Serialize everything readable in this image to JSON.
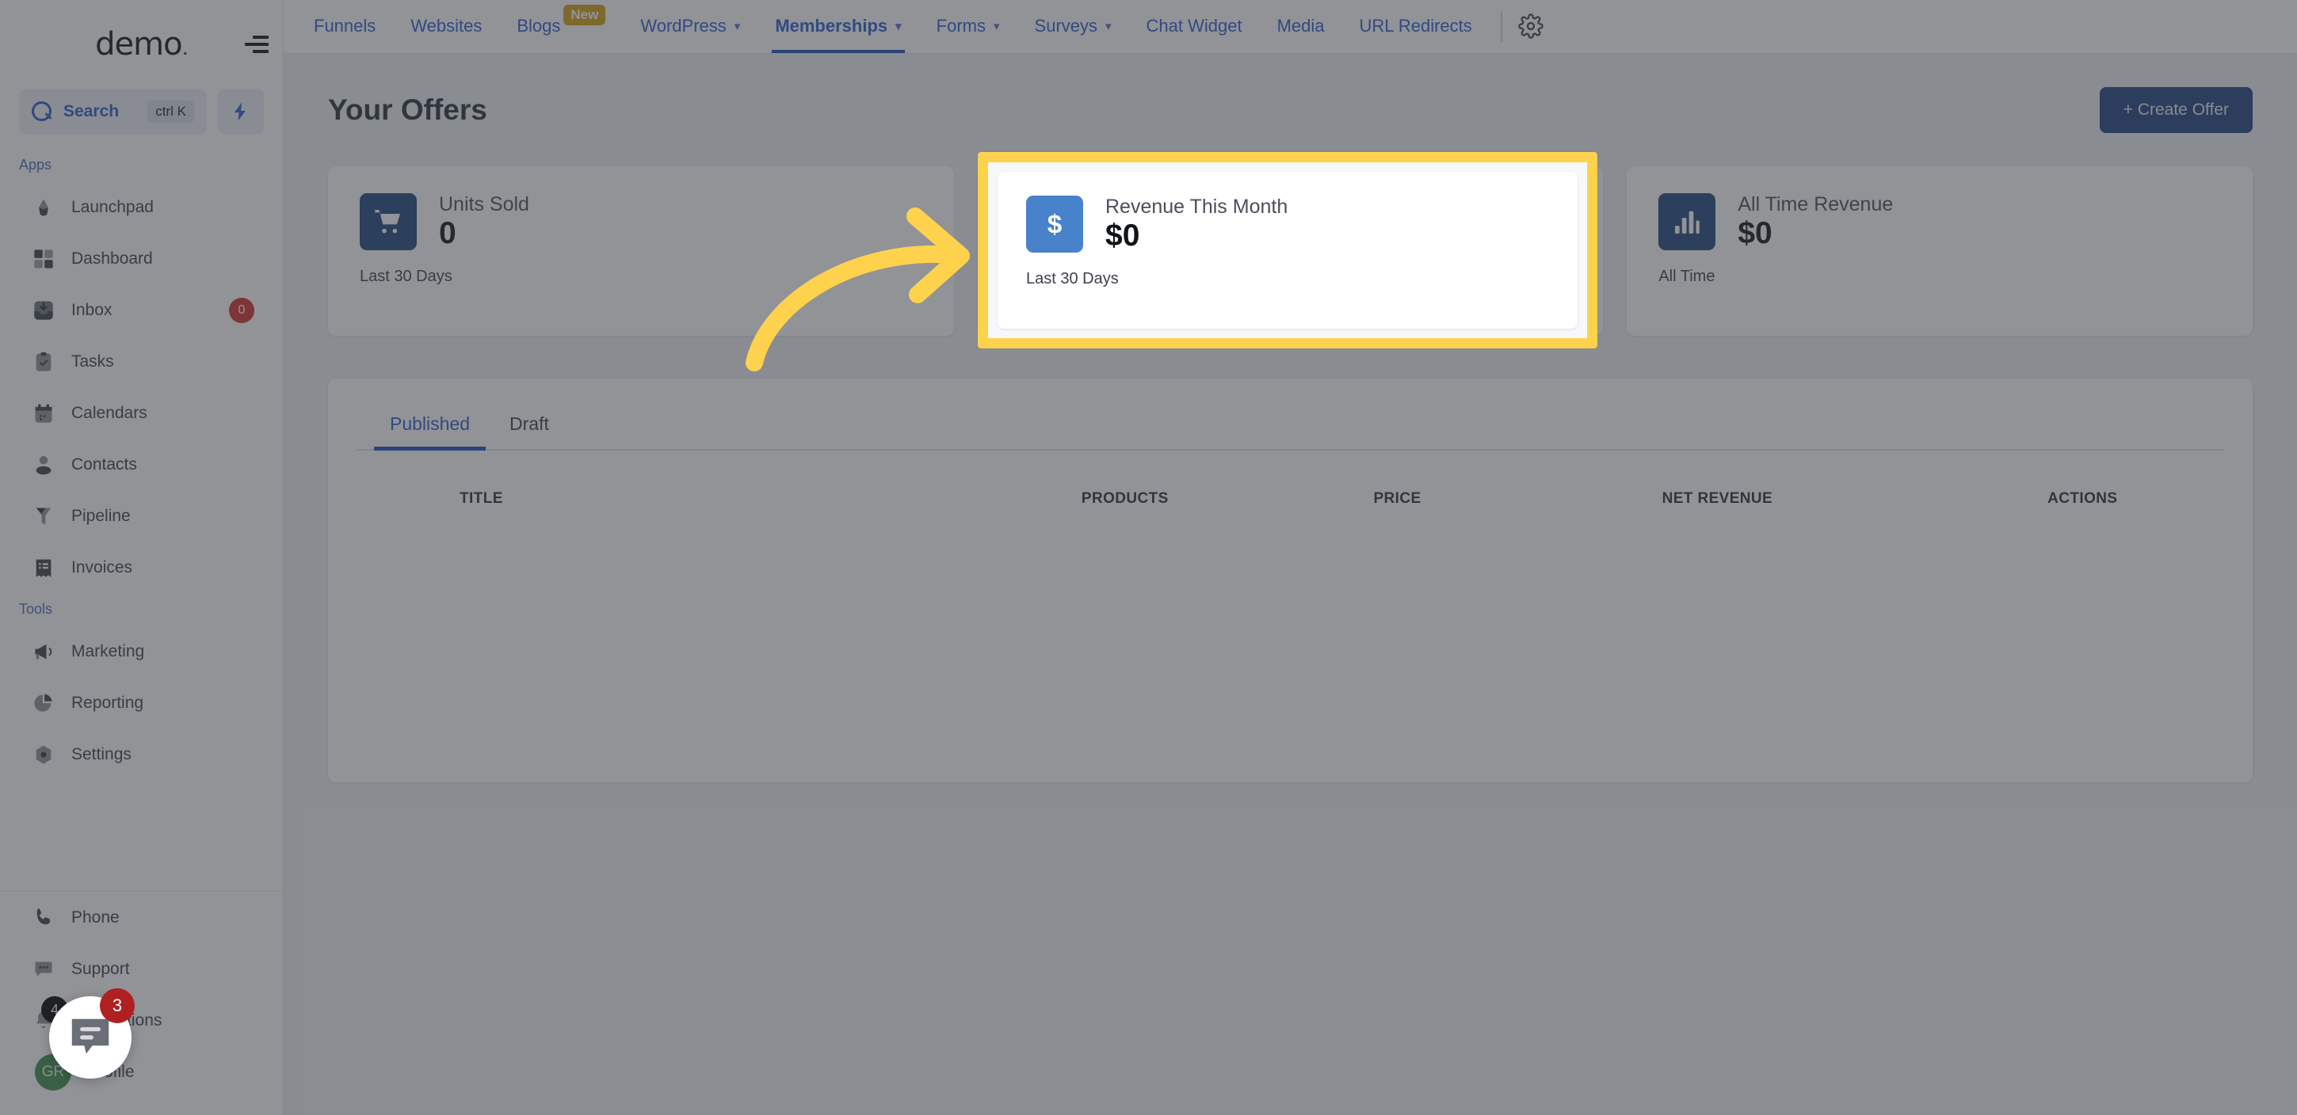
{
  "sidebar": {
    "brand": "demo",
    "brand_dot": ".",
    "search": {
      "label": "Search",
      "shortcut": "ctrl K",
      "icon": "search-icon"
    },
    "quick_action_icon": "bolt-icon",
    "sections": [
      {
        "label": "Apps",
        "items": [
          {
            "label": "Launchpad",
            "icon": "launchpad-icon"
          },
          {
            "label": "Dashboard",
            "icon": "dashboard-grid-icon"
          },
          {
            "label": "Inbox",
            "icon": "inbox-icon",
            "badge": "0"
          },
          {
            "label": "Tasks",
            "icon": "clipboard-check-icon"
          },
          {
            "label": "Calendars",
            "icon": "calendar-icon"
          },
          {
            "label": "Contacts",
            "icon": "person-icon"
          },
          {
            "label": "Pipeline",
            "icon": "funnel-icon"
          },
          {
            "label": "Invoices",
            "icon": "invoice-list-icon"
          }
        ]
      },
      {
        "label": "Tools",
        "items": [
          {
            "label": "Marketing",
            "icon": "megaphone-icon"
          },
          {
            "label": "Reporting",
            "icon": "pie-chart-icon"
          },
          {
            "label": "Settings",
            "icon": "gear-hex-icon"
          }
        ]
      }
    ],
    "bottom_items": [
      {
        "label": "Phone",
        "icon": "phone-icon"
      },
      {
        "label": "Support",
        "icon": "chat-dots-icon"
      },
      {
        "label": "Notifications",
        "icon": "bell-icon",
        "badge": "4"
      },
      {
        "label": "Profile",
        "icon": "avatar",
        "avatar_initials": "GR"
      }
    ]
  },
  "topnav": {
    "collapse_icon": "collapse-menu-icon",
    "items": [
      {
        "label": "Funnels",
        "caret": false,
        "active": false
      },
      {
        "label": "Websites",
        "caret": false,
        "active": false
      },
      {
        "label": "Blogs",
        "caret": false,
        "active": false,
        "badge": "New"
      },
      {
        "label": "WordPress",
        "caret": true,
        "active": false
      },
      {
        "label": "Memberships",
        "caret": true,
        "active": true
      },
      {
        "label": "Forms",
        "caret": true,
        "active": false
      },
      {
        "label": "Surveys",
        "caret": true,
        "active": false
      },
      {
        "label": "Chat Widget",
        "caret": false,
        "active": false
      },
      {
        "label": "Media",
        "caret": false,
        "active": false
      },
      {
        "label": "URL Redirects",
        "caret": false,
        "active": false
      }
    ],
    "settings_icon": "gear-icon"
  },
  "main": {
    "title": "Your Offers",
    "create_button": "+ Create Offer",
    "stats": [
      {
        "title": "Units Sold",
        "value": "0",
        "sub": "Last 30 Days",
        "icon": "shopping-cart-icon"
      },
      {
        "title": "Revenue This Month",
        "value": "$0",
        "sub": "Last 30 Days",
        "icon": "dollar-icon"
      },
      {
        "title": "All Time Revenue",
        "value": "$0",
        "sub": "All Time",
        "icon": "bar-chart-icon"
      }
    ],
    "tabs": [
      {
        "label": "Published",
        "active": true
      },
      {
        "label": "Draft",
        "active": false
      }
    ],
    "table": {
      "columns": [
        "TITLE",
        "PRODUCTS",
        "PRICE",
        "NET REVENUE",
        "ACTIONS"
      ],
      "rows": []
    }
  },
  "annotation": {
    "highlight_color": "#ffd24d",
    "arrow_color": "#ffd24d",
    "highlighted_card": "Revenue This Month"
  },
  "chat": {
    "badge": "3",
    "icon": "chat-bubble-icon"
  },
  "colors": {
    "accent_blue": "#2d5bd0",
    "brand_dark_blue": "#204080",
    "icon_blue": "#21457f",
    "icon_blue_light": "#4782cb",
    "badge_red": "#d32f2f",
    "avatar_green": "#3c8f4f",
    "highlight_yellow": "#ffd24d"
  }
}
